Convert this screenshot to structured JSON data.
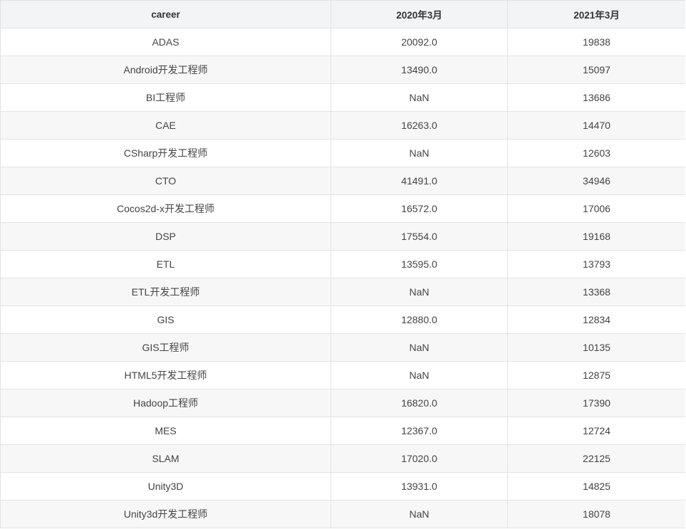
{
  "table": {
    "headers": [
      "career",
      "2020年3月",
      "2021年3月"
    ],
    "rows": [
      [
        "ADAS",
        "20092.0",
        "19838"
      ],
      [
        "Android开发工程师",
        "13490.0",
        "15097"
      ],
      [
        "BI工程师",
        "NaN",
        "13686"
      ],
      [
        "CAE",
        "16263.0",
        "14470"
      ],
      [
        "CSharp开发工程师",
        "NaN",
        "12603"
      ],
      [
        "CTO",
        "41491.0",
        "34946"
      ],
      [
        "Cocos2d-x开发工程师",
        "16572.0",
        "17006"
      ],
      [
        "DSP",
        "17554.0",
        "19168"
      ],
      [
        "ETL",
        "13595.0",
        "13793"
      ],
      [
        "ETL开发工程师",
        "NaN",
        "13368"
      ],
      [
        "GIS",
        "12880.0",
        "12834"
      ],
      [
        "GIS工程师",
        "NaN",
        "10135"
      ],
      [
        "HTML5开发工程师",
        "NaN",
        "12875"
      ],
      [
        "Hadoop工程师",
        "16820.0",
        "17390"
      ],
      [
        "MES",
        "12367.0",
        "12724"
      ],
      [
        "SLAM",
        "17020.0",
        "22125"
      ],
      [
        "Unity3D",
        "13931.0",
        "14825"
      ],
      [
        "Unity3d开发工程师",
        "NaN",
        "18078"
      ]
    ]
  }
}
